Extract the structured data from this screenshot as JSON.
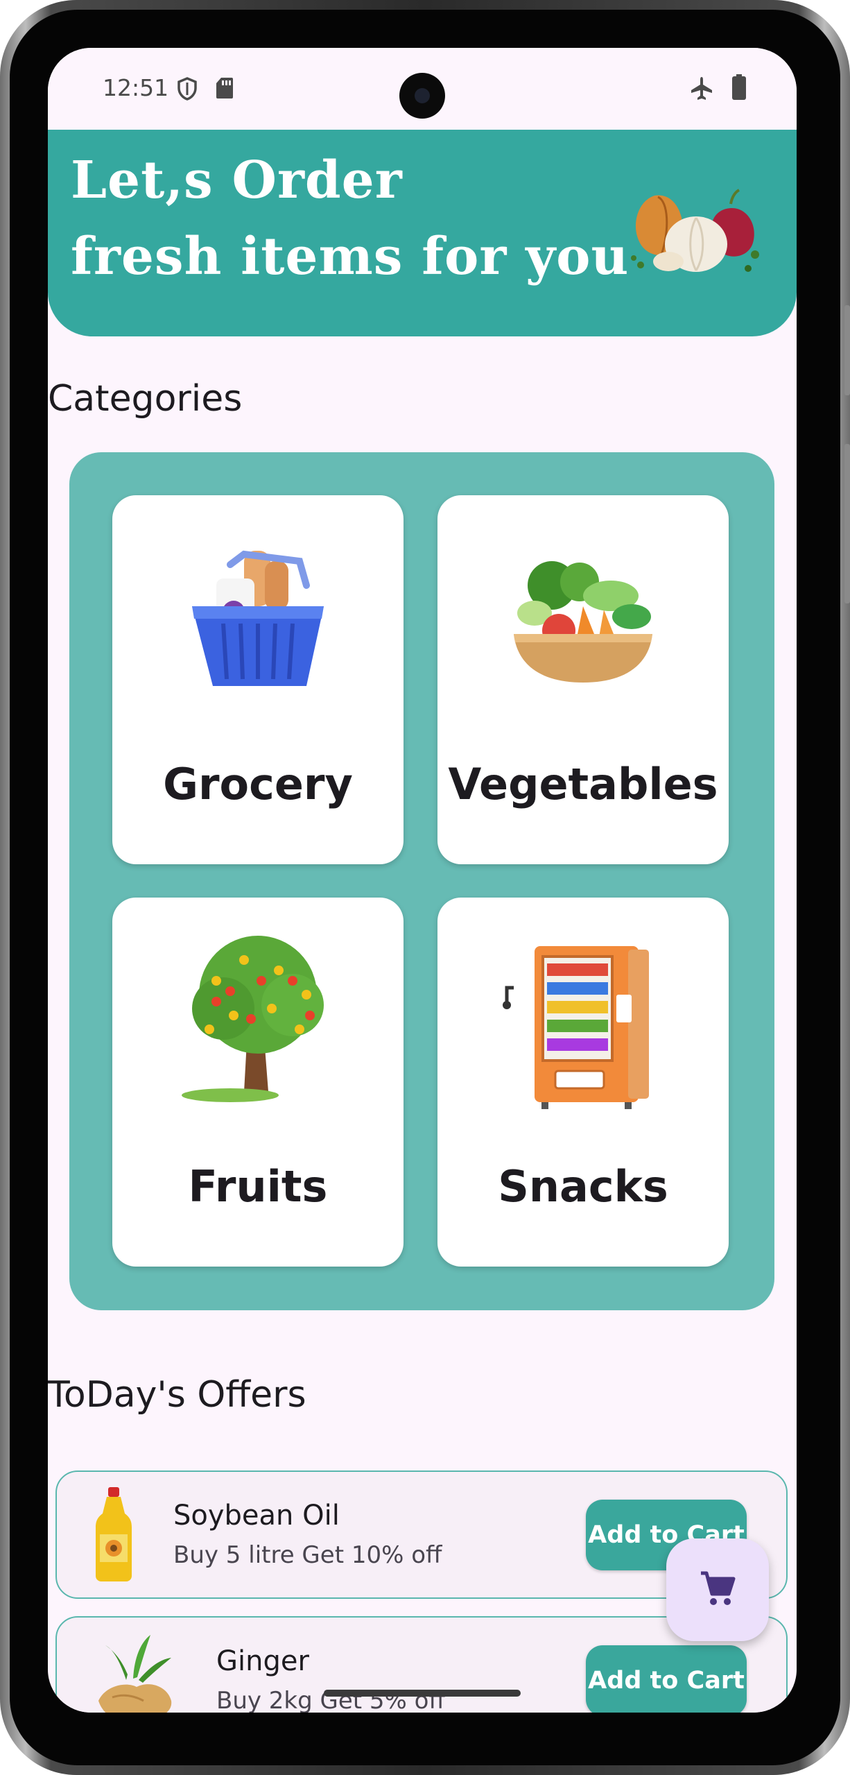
{
  "status_bar": {
    "time": "12:51",
    "icons": [
      "shield-icon",
      "sd-card-icon",
      "airplane-mode-icon",
      "battery-icon"
    ]
  },
  "banner": {
    "line1": "Let,s Order",
    "line2": "fresh items for you",
    "illustration": "onion-garlic-illustration",
    "color": "#35a89f"
  },
  "categories": {
    "title": "Categories",
    "panel_color": "#66bbb4",
    "items": [
      {
        "label": "Grocery",
        "icon": "grocery-basket-icon"
      },
      {
        "label": "Vegetables",
        "icon": "vegetable-bowl-icon"
      },
      {
        "label": "Fruits",
        "icon": "fruit-tree-icon"
      },
      {
        "label": "Snacks",
        "icon": "vending-machine-icon"
      }
    ]
  },
  "offers": {
    "title": "ToDay's Offers",
    "items": [
      {
        "name": "Soybean Oil",
        "description": "Buy 5 litre Get 10% off",
        "button": "Add to Cart",
        "icon": "oil-bottle-icon"
      },
      {
        "name": "Ginger",
        "description": "Buy 2kg Get 5% off",
        "button": "Add to Cart",
        "icon": "ginger-icon"
      }
    ]
  },
  "fab": {
    "icon": "shopping-cart-icon",
    "color": "#ece0fb"
  },
  "accent_color": "#3aa79c"
}
